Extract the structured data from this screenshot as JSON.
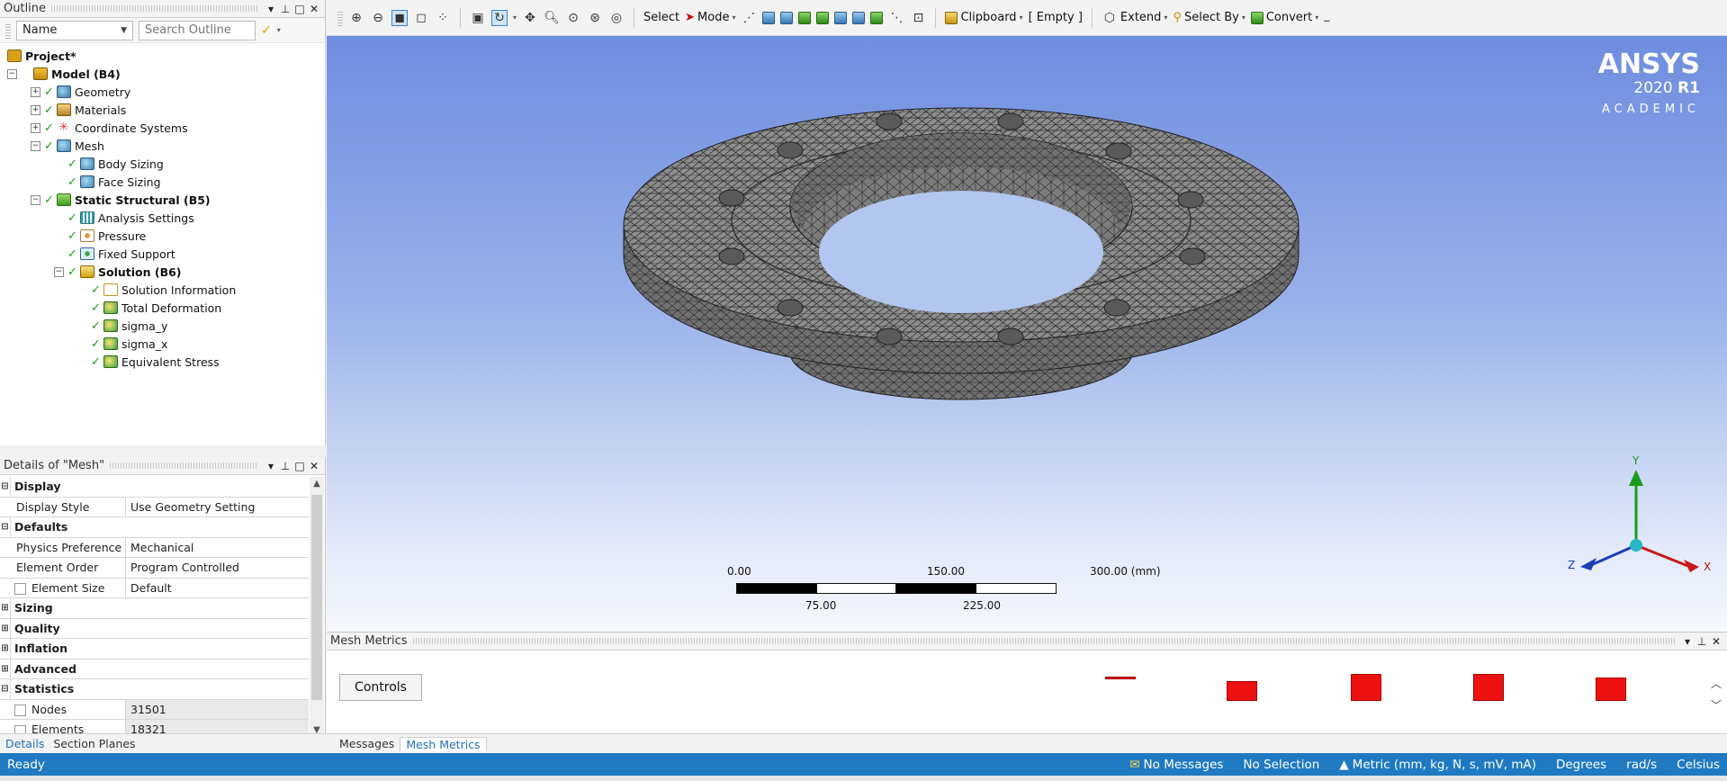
{
  "outline": {
    "title": "Outline",
    "filter_value": "Name",
    "search_placeholder": "Search Outline",
    "tree": [
      {
        "label": "Project*",
        "bold": true,
        "icon": "project-icon",
        "depth": 0
      },
      {
        "label": "Model (B4)",
        "bold": true,
        "icon": "model-icon",
        "depth": 1
      },
      {
        "label": "Geometry",
        "bold": false,
        "icon": "geometry-icon",
        "depth": 2
      },
      {
        "label": "Materials",
        "bold": false,
        "icon": "materials-icon",
        "depth": 2
      },
      {
        "label": "Coordinate Systems",
        "bold": false,
        "icon": "coordinate-systems-icon",
        "depth": 2
      },
      {
        "label": "Mesh",
        "bold": false,
        "icon": "mesh-icon",
        "depth": 2
      },
      {
        "label": "Body Sizing",
        "bold": false,
        "icon": "sizing-icon",
        "depth": 3
      },
      {
        "label": "Face Sizing",
        "bold": false,
        "icon": "sizing-icon",
        "depth": 3
      },
      {
        "label": "Static Structural (B5)",
        "bold": true,
        "icon": "static-structural-icon",
        "depth": 2
      },
      {
        "label": "Analysis Settings",
        "bold": false,
        "icon": "analysis-settings-icon",
        "depth": 3
      },
      {
        "label": "Pressure",
        "bold": false,
        "icon": "pressure-icon",
        "depth": 3
      },
      {
        "label": "Fixed Support",
        "bold": false,
        "icon": "fixed-support-icon",
        "depth": 3
      },
      {
        "label": "Solution (B6)",
        "bold": true,
        "icon": "solution-icon",
        "depth": 3
      },
      {
        "label": "Solution Information",
        "bold": false,
        "icon": "solution-information-icon",
        "depth": 4
      },
      {
        "label": "Total Deformation",
        "bold": false,
        "icon": "result-icon",
        "depth": 4
      },
      {
        "label": "sigma_y",
        "bold": false,
        "icon": "result-icon",
        "depth": 4
      },
      {
        "label": "sigma_x",
        "bold": false,
        "icon": "result-icon",
        "depth": 4
      },
      {
        "label": "Equivalent Stress",
        "bold": false,
        "icon": "result-icon",
        "depth": 4
      }
    ]
  },
  "details": {
    "title": "Details of \"Mesh\"",
    "rows": [
      {
        "type": "group",
        "label": "Display",
        "expanded": true
      },
      {
        "type": "prop",
        "key": "Display Style",
        "value": "Use Geometry Setting"
      },
      {
        "type": "group",
        "label": "Defaults",
        "expanded": true
      },
      {
        "type": "prop",
        "key": "Physics Preference",
        "value": "Mechanical"
      },
      {
        "type": "prop",
        "key": "Element Order",
        "value": "Program Controlled"
      },
      {
        "type": "prop",
        "key": "Element Size",
        "value": "Default",
        "checkbox": true
      },
      {
        "type": "group",
        "label": "Sizing",
        "expanded": false
      },
      {
        "type": "group",
        "label": "Quality",
        "expanded": false
      },
      {
        "type": "group",
        "label": "Inflation",
        "expanded": false
      },
      {
        "type": "group",
        "label": "Advanced",
        "expanded": false
      },
      {
        "type": "group",
        "label": "Statistics",
        "expanded": true
      },
      {
        "type": "prop",
        "key": "Nodes",
        "value": "31501",
        "checkbox": true,
        "shade": true
      },
      {
        "type": "prop",
        "key": "Elements",
        "value": "18321",
        "checkbox": true,
        "shade": true
      }
    ]
  },
  "left_tabs": [
    "Details",
    "Section Planes"
  ],
  "toolbar": {
    "select_label": "Select",
    "mode_label": "Mode",
    "clipboard_label": "Clipboard",
    "empty_label": "[ Empty ]",
    "extend_label": "Extend",
    "select_by_label": "Select By",
    "convert_label": "Convert"
  },
  "logo": {
    "brand": "ANSYS",
    "version_num": "2020",
    "version_rel": "R1",
    "edition": "ACADEMIC"
  },
  "scale_bar": {
    "top_labels": [
      "0.00",
      "150.00",
      "300.00 (mm)"
    ],
    "bottom_labels": [
      "75.00",
      "225.00"
    ]
  },
  "triad": {
    "y_label": "Y",
    "z_label": "Z",
    "x_label": "X"
  },
  "metrics": {
    "title": "Mesh Metrics",
    "controls_label": "Controls",
    "bars": [
      0.05,
      0.55,
      0.75,
      0.75,
      0.65
    ],
    "bar_color": "#ee1111"
  },
  "bottom_tabs": [
    "Messages",
    "Mesh Metrics"
  ],
  "status": {
    "left": "Ready",
    "messages": "No Messages",
    "selection": "No Selection",
    "units": "Metric (mm, kg, N, s, mV, mA)",
    "angle": "Degrees",
    "rot": "rad/s",
    "temp": "Celsius"
  }
}
